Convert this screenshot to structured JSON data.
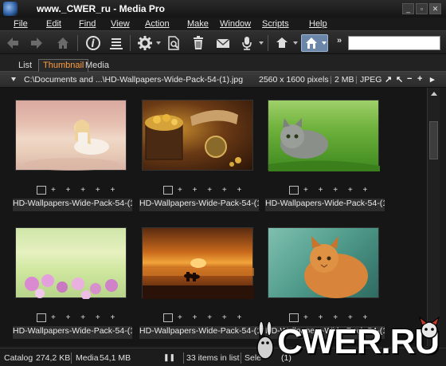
{
  "window": {
    "title": "www._CWER_ru - Media Pro"
  },
  "menu": [
    "File",
    "Edit",
    "Find",
    "View",
    "Action",
    "Make",
    "Window",
    "Scripts",
    "Help"
  ],
  "toolbar": {
    "icons": [
      "back-arrow-icon",
      "forward-arrow-icon",
      "home-icon",
      "info-icon",
      "list-icon",
      "gear-icon",
      "find-in-page-icon",
      "trash-icon",
      "mail-icon",
      "microphone-icon",
      "upload-icon",
      "catalog-icon"
    ],
    "more": "»",
    "search_placeholder": ""
  },
  "tabs": [
    {
      "label": "List",
      "active": false
    },
    {
      "label": "Thumbnail",
      "active": true
    },
    {
      "label": "Media",
      "active": false
    }
  ],
  "pathbar": {
    "path": "C:\\Documents and ...\\HD-Wallpapers-Wide-Pack-54-(1).jpg",
    "dimensions": "2560 x 1600 pixels",
    "size": "2 MB",
    "format": "JPEG",
    "controls": [
      "↗",
      "↖",
      "−",
      "+",
      "▸"
    ]
  },
  "thumbnails": [
    {
      "caption": "HD-Wallpapers-Wide-Pack-54-(1...",
      "scene": "woman-on-beach",
      "selected": true
    },
    {
      "caption": "HD-Wallpapers-Wide-Pack-54-(1...",
      "scene": "treasure-chest",
      "selected": true
    },
    {
      "caption": "HD-Wallpapers-Wide-Pack-54-(1...",
      "scene": "kitten-in-grass",
      "selected": true
    },
    {
      "caption": "HD-Wallpapers-Wide-Pack-54-(1...",
      "scene": "flowers",
      "selected": true
    },
    {
      "caption": "HD-Wallpapers-Wide-Pack-54-(1...",
      "scene": "sunset-riders",
      "selected": true
    },
    {
      "caption": "HD-Wallpapers-Wide-Pack-54-(1...",
      "scene": "orange-cat",
      "selected": true
    }
  ],
  "rating_marks": "+ + + + +",
  "status": {
    "catalog_label": "Catalog",
    "catalog_size": "274,2 KB",
    "media_label": "Media",
    "media_size": "54,1 MB",
    "pause": "❚❚",
    "count": "33 items in list",
    "selection": "Sele",
    "selection_count": "(1)"
  },
  "watermark": "CWER.RU"
}
